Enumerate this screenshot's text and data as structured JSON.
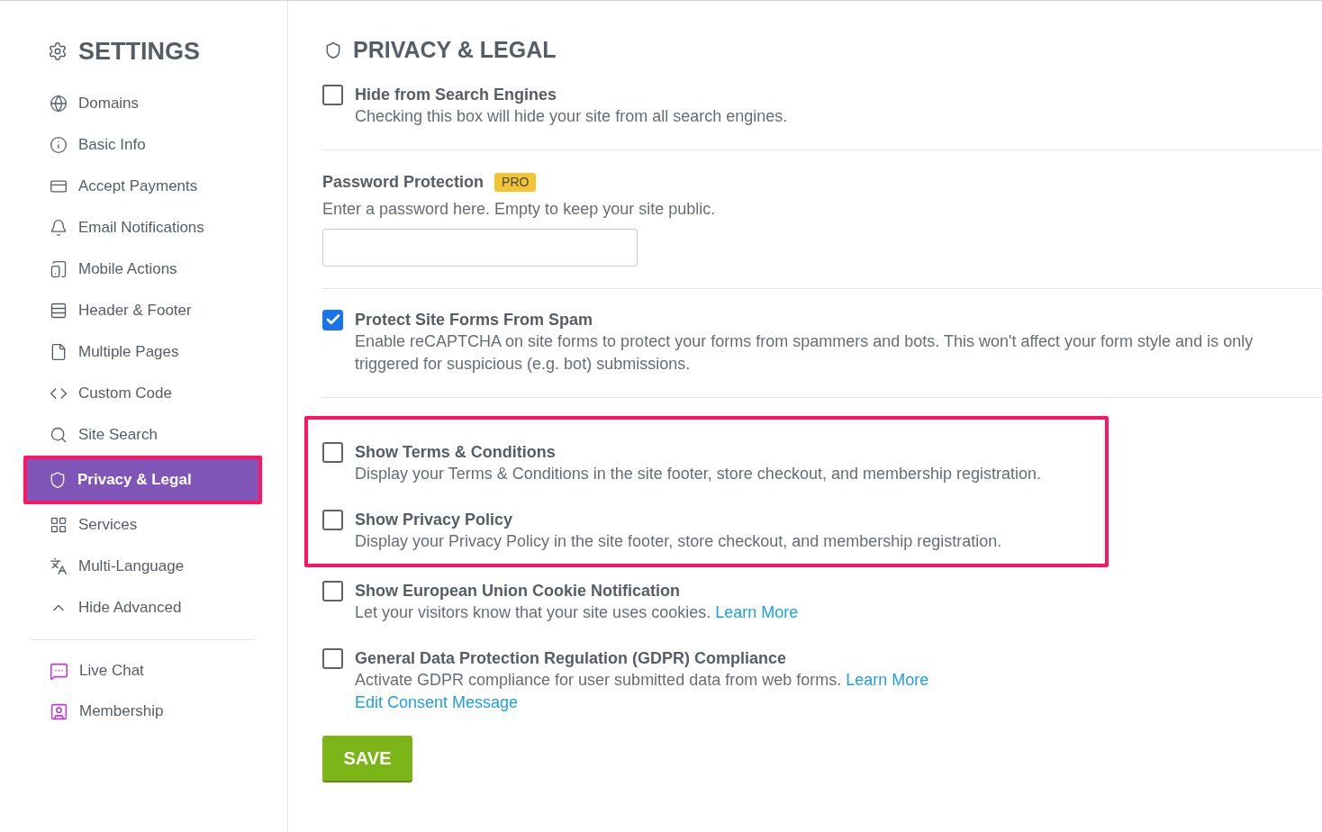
{
  "sidebar": {
    "title": "SETTINGS",
    "items": [
      {
        "label": "Domains",
        "selected": false,
        "highlighted": false
      },
      {
        "label": "Basic Info",
        "selected": false,
        "highlighted": false
      },
      {
        "label": "Accept Payments",
        "selected": false,
        "highlighted": false
      },
      {
        "label": "Email Notifications",
        "selected": false,
        "highlighted": false
      },
      {
        "label": "Mobile Actions",
        "selected": false,
        "highlighted": false
      },
      {
        "label": "Header & Footer",
        "selected": false,
        "highlighted": false
      },
      {
        "label": "Multiple Pages",
        "selected": false,
        "highlighted": false
      },
      {
        "label": "Custom Code",
        "selected": false,
        "highlighted": false
      },
      {
        "label": "Site Search",
        "selected": false,
        "highlighted": false
      },
      {
        "label": "Privacy & Legal",
        "selected": true,
        "highlighted": true
      },
      {
        "label": "Services",
        "selected": false,
        "highlighted": false
      },
      {
        "label": "Multi-Language",
        "selected": false,
        "highlighted": false
      },
      {
        "label": "Hide Advanced",
        "selected": false,
        "highlighted": false
      }
    ],
    "extras": [
      {
        "label": "Live Chat"
      },
      {
        "label": "Membership"
      }
    ]
  },
  "main": {
    "title": "PRIVACY & LEGAL",
    "sections": [
      {
        "highlighted": false,
        "divider_after": true,
        "options": [
          {
            "kind": "checkbox",
            "label": "Hide from Search Engines",
            "checked": false,
            "description": "Checking this box will hide your site from all search engines."
          }
        ]
      },
      {
        "highlighted": false,
        "divider_after": true,
        "options": [
          {
            "kind": "password",
            "label": "Password Protection",
            "badge": "PRO",
            "description": "Enter a password here. Empty to keep your site public."
          }
        ]
      },
      {
        "highlighted": false,
        "divider_after": true,
        "options": [
          {
            "kind": "checkbox",
            "label": "Protect Site Forms From Spam",
            "checked": true,
            "description": "Enable reCAPTCHA on site forms to protect your forms from spammers and bots. This won't affect your form style and is only triggered for suspicious (e.g. bot) submissions."
          }
        ]
      },
      {
        "highlighted": true,
        "divider_after": false,
        "options": [
          {
            "kind": "checkbox",
            "label": "Show Terms & Conditions",
            "checked": false,
            "description": "Display your Terms & Conditions in the site footer, store checkout, and membership registration."
          },
          {
            "kind": "checkbox",
            "label": "Show Privacy Policy",
            "checked": false,
            "description": "Display your Privacy Policy in the site footer, store checkout, and membership registration."
          }
        ]
      },
      {
        "highlighted": false,
        "divider_after": false,
        "options": [
          {
            "kind": "checkbox",
            "label": "Show European Union Cookie Notification",
            "checked": false,
            "description": "Let your visitors know that your site uses cookies.",
            "link": "Learn More"
          },
          {
            "kind": "checkbox",
            "label": "General Data Protection Regulation (GDPR) Compliance",
            "checked": false,
            "description": "Activate GDPR compliance for user submitted data from web forms.",
            "link": "Learn More",
            "second_link": "Edit Consent Message"
          }
        ]
      }
    ],
    "save": "SAVE"
  }
}
